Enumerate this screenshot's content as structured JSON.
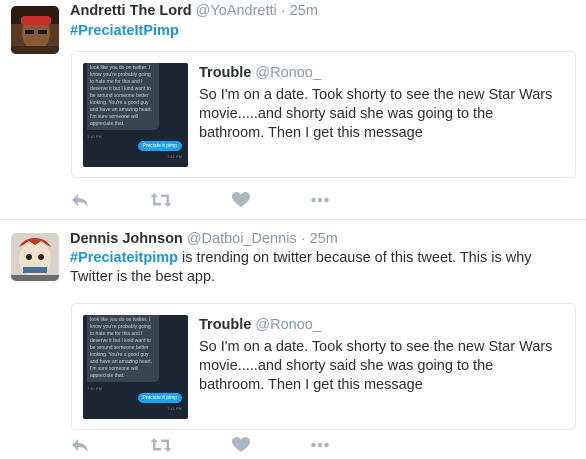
{
  "tweets": [
    {
      "fullname": "Andretti The Lord",
      "username": "@YoAndretti",
      "separator": "·",
      "time": "25m",
      "hashtag": "#PreciateItPimp",
      "text_rest": "",
      "quote": {
        "name": "Trouble",
        "handle": "@Ronoo_",
        "text": "So I'm on a date. Took shorty to see the new Star Wars movie.....and shorty said she was going to the bathroom. Then I get this message",
        "image": {
          "message": "look like you do on twitter. I know you're probably going to hate me for this and I deserve it but I kind want to be around someone better looking. You're a good guy and have an amazing heart. I'm sure someone will appreciate that.",
          "timestamp": "7:40 PM",
          "reply": "Preciate it pimp",
          "read": "7:41 PM"
        }
      }
    },
    {
      "fullname": "Dennis Johnson",
      "username": "@Datboi_Dennis",
      "separator": "·",
      "time": "25m",
      "hashtag": "#Preciateitpimp",
      "text_rest": " is trending on twitter because of this tweet. This is why Twitter is the best app.",
      "quote": {
        "name": "Trouble",
        "handle": "@Ronoo_",
        "text": "So I'm on a date. Took shorty to see the new Star Wars movie.....and shorty said she was going to the bathroom. Then I get this message",
        "image": {
          "message": "look like you do on twitter. I know you're probably going to hate me for this and I deserve it but I kind want to be around someone better looking. You're a good guy and have an amazing heart. I'm sure someone will appreciate that.",
          "timestamp": "7:40 PM",
          "reply": "Preciate it pimp",
          "read": "7:41 PM"
        }
      }
    }
  ],
  "icons": {
    "reply": "reply-icon",
    "retweet": "retweet-icon",
    "like": "heart-icon",
    "more": "more-dots-icon"
  },
  "colors": {
    "hashtag": "#1b95e0",
    "secondary_text": "#8899a6",
    "action_icon": "#aab8c2",
    "border": "#e1e8ed",
    "dm_background": "#1c2733",
    "dm_bubble_sent": "#1da1f2"
  }
}
